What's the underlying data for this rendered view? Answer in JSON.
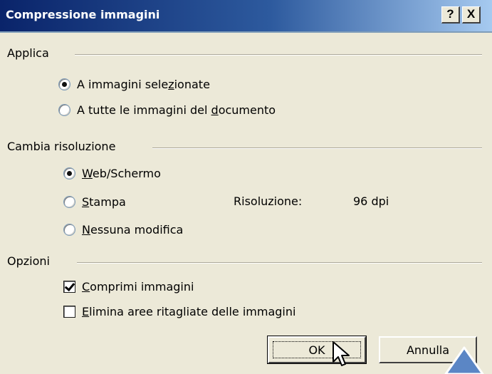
{
  "window": {
    "title": "Compressione immagini",
    "help_label": "?",
    "close_label": "X"
  },
  "groups": {
    "applica": {
      "label": "Applica",
      "options": [
        {
          "pre": "A immagini sele",
          "key": "z",
          "post": "ionate",
          "selected": true
        },
        {
          "pre": "A tutte le immagini del ",
          "key": "d",
          "post": "ocumento",
          "selected": false
        }
      ]
    },
    "risoluzione": {
      "label": "Cambia risoluzione",
      "options": [
        {
          "pre": "",
          "key": "W",
          "post": "eb/Schermo",
          "selected": true
        },
        {
          "pre": "",
          "key": "S",
          "post": "tampa",
          "selected": false
        },
        {
          "pre": "",
          "key": "N",
          "post": "essuna modifica",
          "selected": false
        }
      ],
      "resolution_label": "Risoluzione:",
      "resolution_value": "96 dpi"
    },
    "opzioni": {
      "label": "Opzioni",
      "checks": [
        {
          "pre": "",
          "key": "C",
          "post": "omprimi immagini",
          "checked": true
        },
        {
          "pre": "",
          "key": "E",
          "post": "limina aree ritagliate delle immagini",
          "checked": false
        }
      ]
    }
  },
  "buttons": {
    "ok": "OK",
    "cancel": "Annulla"
  },
  "colors": {
    "titlebar_start": "#0a246a",
    "titlebar_end": "#a6caf0",
    "face": "#ece9d8",
    "callout": "#5b86c5"
  },
  "icons": {
    "cursor": "mouse-pointer-icon",
    "callout": "triangle-pointer-icon"
  }
}
